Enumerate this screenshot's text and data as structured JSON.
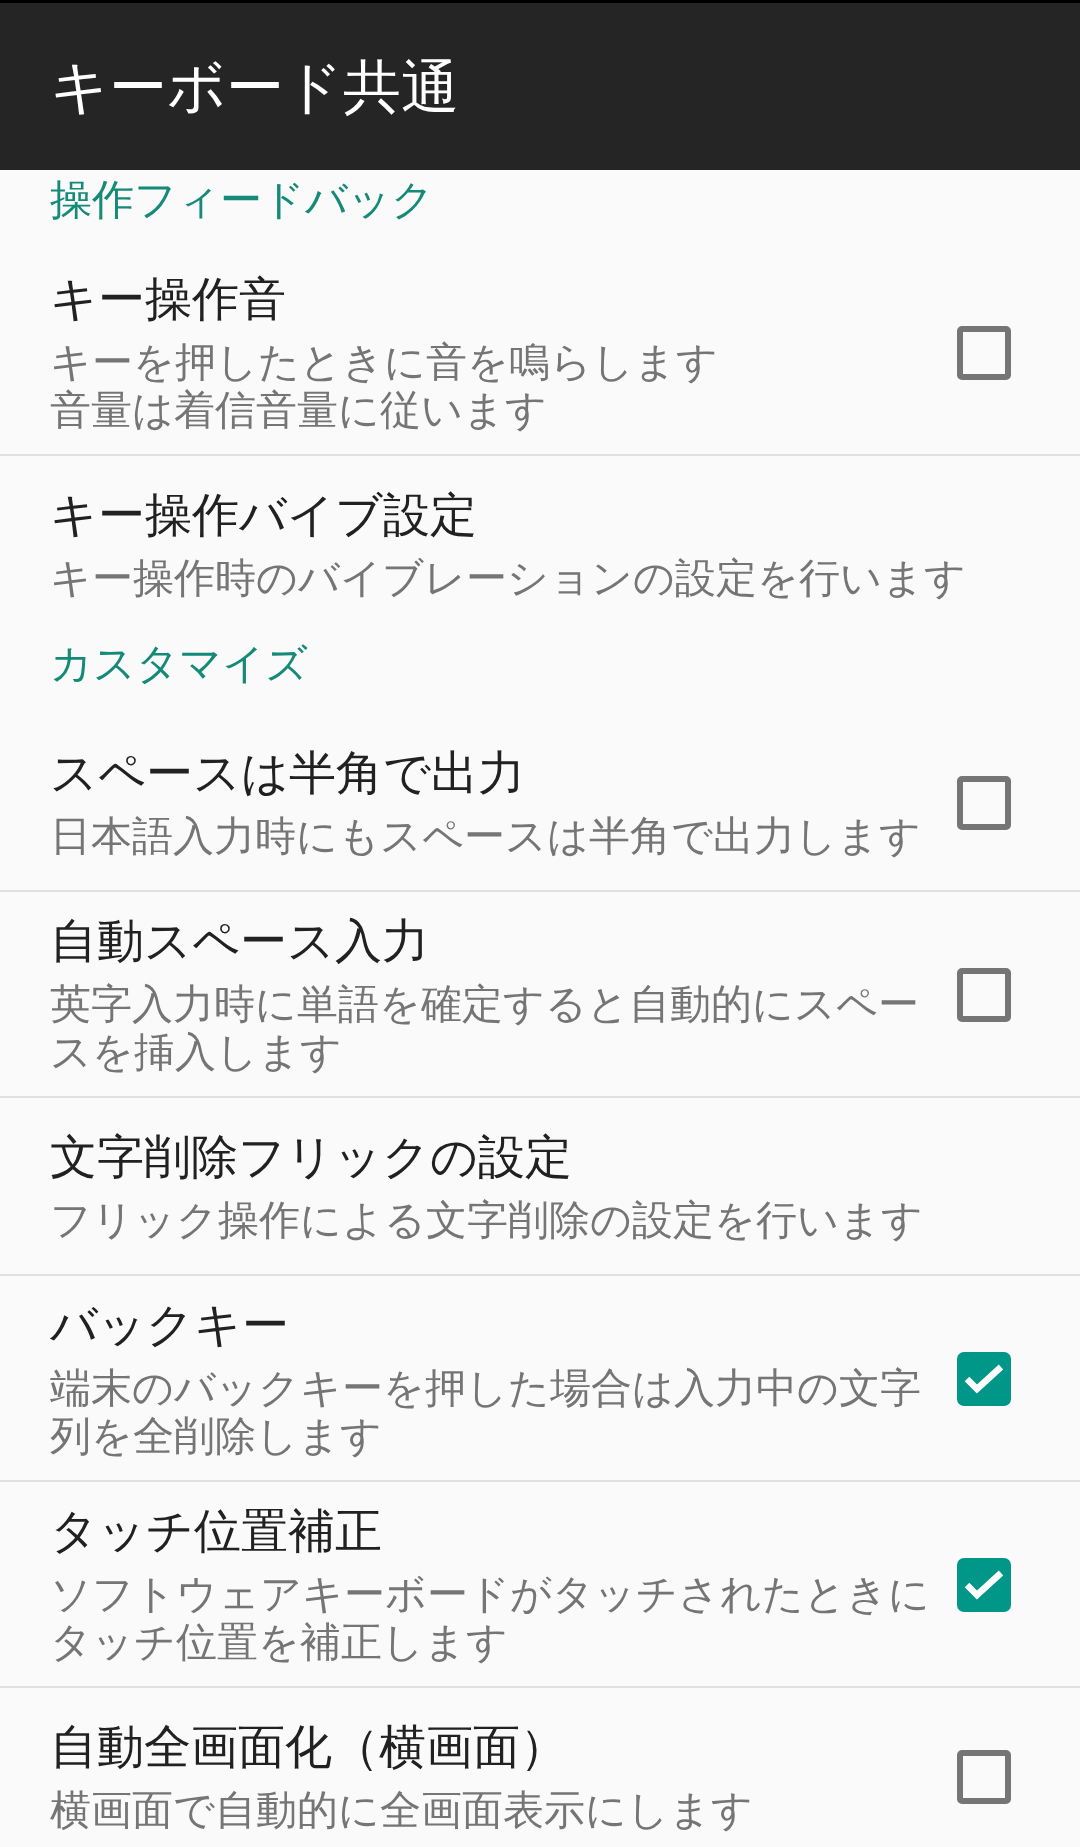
{
  "app_bar": {
    "title": "キーボード共通"
  },
  "sections": [
    {
      "header": "操作フィードバック",
      "items": [
        {
          "kind": "checkbox",
          "title": "キー操作音",
          "summary": [
            "キーを押したときに音を鳴らします",
            "音量は着信音量に従います"
          ],
          "checked": false
        },
        {
          "kind": "link",
          "title": "キー操作バイブ設定",
          "summary": [
            "キー操作時のバイブレーションの設定を行います"
          ]
        }
      ]
    },
    {
      "header": "カスタマイズ",
      "items": [
        {
          "kind": "checkbox",
          "title": "スペースは半角で出力",
          "summary": [
            "日本語入力時にもスペースは半角で出力します"
          ],
          "checked": false
        },
        {
          "kind": "checkbox",
          "title": "自動スペース入力",
          "summary": [
            "英字入力時に単語を確定すると自動的にスペースを挿入します"
          ],
          "checked": false
        },
        {
          "kind": "link",
          "title": "文字削除フリックの設定",
          "summary": [
            "フリック操作による文字削除の設定を行います"
          ]
        },
        {
          "kind": "checkbox",
          "title": "バックキー",
          "summary": [
            "端末のバックキーを押した場合は入力中の文字列を全削除します"
          ],
          "checked": true
        },
        {
          "kind": "checkbox",
          "title": "タッチ位置補正",
          "summary": [
            "ソフトウェアキーボードがタッチされたときにタッチ位置を補正します"
          ],
          "checked": true
        },
        {
          "kind": "checkbox",
          "title": "自動全画面化（横画面）",
          "summary": [
            "横画面で自動的に全画面表示にします"
          ],
          "checked": false
        }
      ]
    }
  ]
}
